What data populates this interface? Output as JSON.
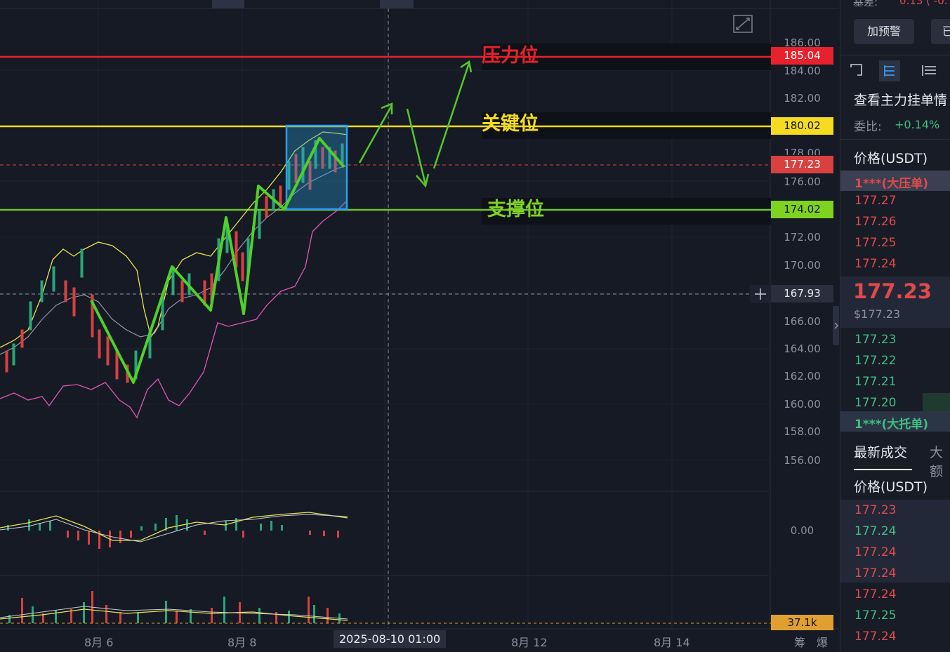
{
  "chart_data": {
    "type": "candlestick-annotated",
    "y_ticks": [
      "186.00",
      "184.00",
      "182.00",
      "178.00",
      "176.00",
      "172.00",
      "170.00",
      "166.00",
      "164.00",
      "162.00",
      "160.00",
      "158.00",
      "156.00"
    ],
    "x_ticks": [
      "8月 6",
      "8月 8",
      "8月 12",
      "8月 14"
    ],
    "crosshair_time": "2025-08-10 01:00",
    "price_tags": {
      "resistance": "185.04",
      "key": "180.02",
      "last": "177.23",
      "cursor": "167.93",
      "support": "174.02"
    },
    "macd_zero_label": "0.00",
    "volume_label": "37.1k",
    "annotations": {
      "resistance": "压力位",
      "key": "关键位",
      "support": "支撑位"
    },
    "bottom_right": [
      "筹",
      "爆"
    ]
  },
  "sidebar": {
    "top_fragment": "0.13 ( -0.",
    "top_left_fragment": "基差:",
    "alert_button": "加预警",
    "other_button": "已",
    "view_orders_title": "查看主力挂单情",
    "commission_label": "委比:",
    "commission_value": "+0.14%",
    "orderbook_header": "价格(USDT)",
    "big_ask": "1***(大压单)",
    "asks": [
      "177.27",
      "177.26",
      "177.25",
      "177.24"
    ],
    "last_price": "177.23",
    "last_price_usd": "$177.23",
    "bids": [
      "177.23",
      "177.22",
      "177.21",
      "177.20"
    ],
    "big_bid": "1***(大托单)",
    "trades_tab_active": "最新成交",
    "trades_tab_other": "大额",
    "trades_header": "价格(USDT)",
    "trades": [
      {
        "price": "177.23",
        "side": "sell"
      },
      {
        "price": "177.24",
        "side": "buy"
      },
      {
        "price": "177.24",
        "side": "sell"
      },
      {
        "price": "177.24",
        "side": "sell"
      },
      {
        "price": "177.24",
        "side": "sell"
      },
      {
        "price": "177.25",
        "side": "buy"
      },
      {
        "price": "177.24",
        "side": "sell"
      }
    ]
  },
  "colors": {
    "resistance": "#e8222c",
    "key": "#f5dc20",
    "support": "#7ed321",
    "last": "#d94040",
    "arrow": "#55c828"
  }
}
